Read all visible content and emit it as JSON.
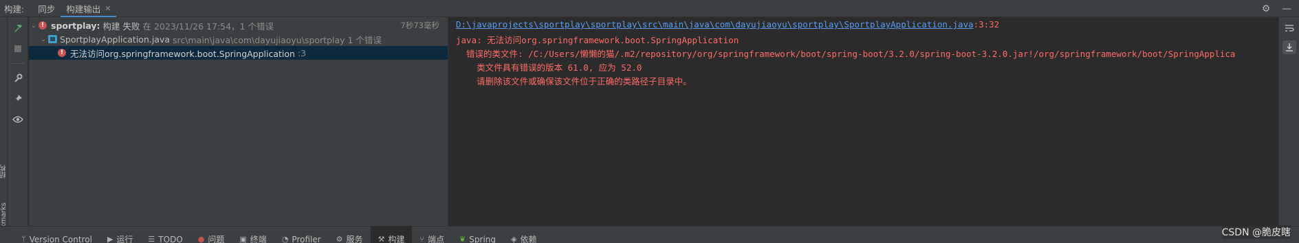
{
  "header": {
    "title": "构建:",
    "tabs": [
      {
        "label": "同步",
        "closable": false
      },
      {
        "label": "构建输出",
        "closable": true
      }
    ]
  },
  "icons": {
    "settings": "gear-icon",
    "minimize": "minimize-icon"
  },
  "left_stripe": {
    "structure": "结构",
    "bookmarks": "Bookmarks"
  },
  "tree": {
    "root": {
      "project": "sportplay:",
      "status": "构建 失败",
      "details": "在 2023/11/26 17:54，1 个错误",
      "timing": "7秒73毫秒"
    },
    "file": {
      "name": "SportplayApplication.java",
      "path": "src\\main\\java\\com\\dayujiaoyu\\sportplay 1 个错误"
    },
    "error": {
      "message": "无法访问org.springframework.boot.SpringApplication",
      "line": ":3"
    }
  },
  "console": {
    "link": "D:\\javaprojects\\sportplay\\sportplay\\src\\main\\java\\com\\dayujiaoyu\\sportplay\\SportplayApplication.java",
    "link_suffix": ":3:32",
    "line1": "java: 无法访问org.springframework.boot.SpringApplication",
    "line2": "  错误的类文件: /C:/Users/懒懒的猫/.m2/repository/org/springframework/boot/spring-boot/3.2.0/spring-boot-3.2.0.jar!/org/springframework/boot/SpringApplica",
    "line3": "    类文件具有错误的版本 61.0, 应为 52.0",
    "line4": "    请删除该文件或确保该文件位于正确的类路径子目录中。"
  },
  "watermark": "CSDN @脆皮瞎",
  "bottom_bar": [
    {
      "icon": "git-branch-icon",
      "label": "Version Control"
    },
    {
      "icon": "run-icon",
      "label": "运行"
    },
    {
      "icon": "list-icon",
      "label": "TODO"
    },
    {
      "icon": "problems-icon",
      "label": "问题"
    },
    {
      "icon": "terminal-icon",
      "label": "终端"
    },
    {
      "icon": "profiler-icon",
      "label": "Profiler"
    },
    {
      "icon": "services-icon",
      "label": "服务"
    },
    {
      "icon": "hammer-icon",
      "label": "构建",
      "active": true
    },
    {
      "icon": "endpoints-icon",
      "label": "端点"
    },
    {
      "icon": "spring-icon",
      "label": "Spring"
    },
    {
      "icon": "dependencies-icon",
      "label": "依赖"
    }
  ],
  "colors": {
    "panel": "#3c3f41",
    "editor": "#2b2b2b",
    "error_red": "#ff6b68",
    "link_blue": "#589df6",
    "selection": "#0d293e",
    "build_green": "#59a869"
  }
}
